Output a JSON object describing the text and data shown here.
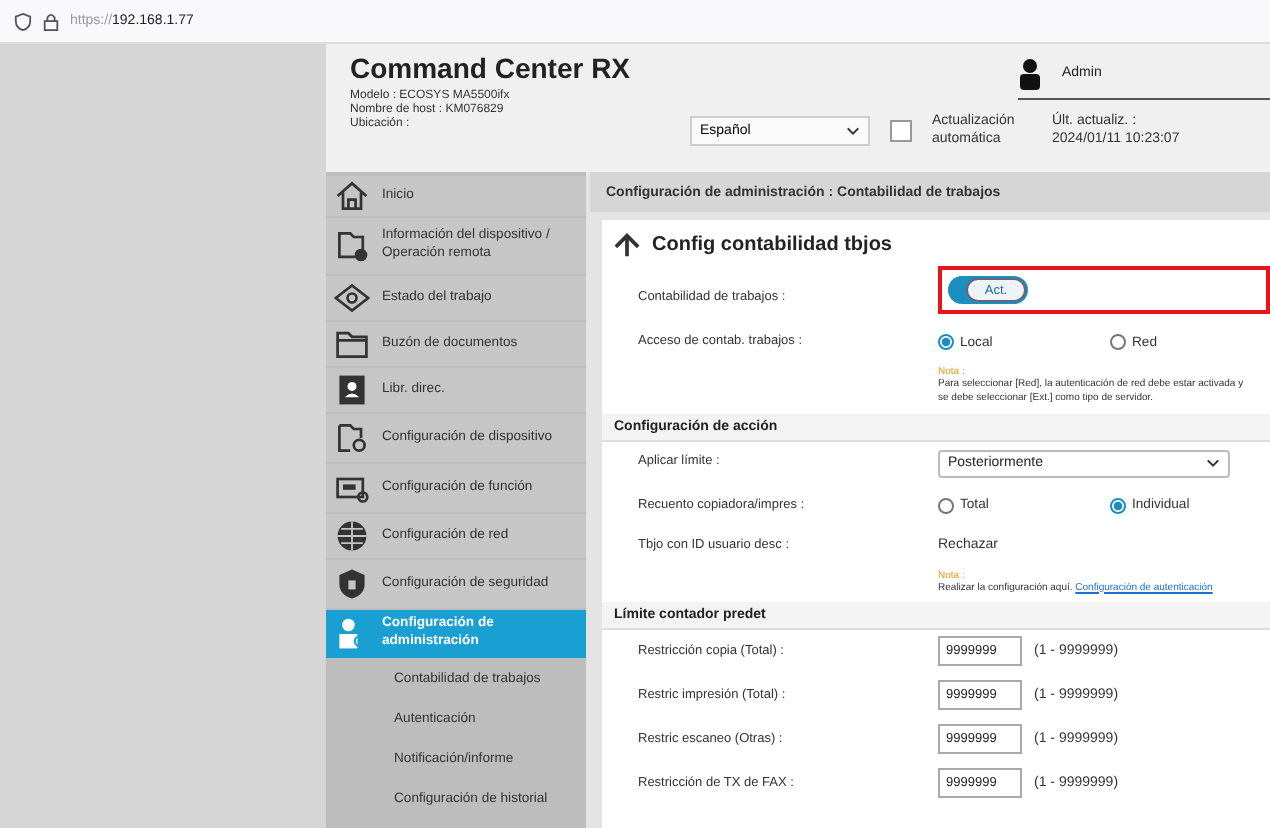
{
  "browser": {
    "url_scheme": "https://",
    "url_host": "192.168.1.77"
  },
  "header": {
    "title": "Command Center RX",
    "info": [
      {
        "label": "Modelo :",
        "value": "ECOSYS MA5500ifx"
      },
      {
        "label": "Nombre de host :",
        "value": "KM076829"
      },
      {
        "label": "Ubicación :"
      }
    ],
    "language": "Español",
    "auto_update": {
      "label": "Actualización automática",
      "checked": false
    },
    "last_update": {
      "label": "Últ. actualiz. :",
      "value": "2024/01/11 10:23:07"
    },
    "user": "Admin"
  },
  "sidebar": {
    "items": [
      {
        "label": "Inicio",
        "selected": false
      },
      {
        "label": "Información del dispositivo / Operación remota",
        "selected": false
      },
      {
        "label": "Estado del trabajo",
        "selected": false
      },
      {
        "label": "Buzón de documentos",
        "selected": false
      },
      {
        "label": "Libr. direc.",
        "selected": false
      },
      {
        "label": "Configuración de dispositivo",
        "selected": false
      },
      {
        "label": "Configuración de función",
        "selected": false
      },
      {
        "label": "Configuración de red",
        "selected": false
      },
      {
        "label": "Configuración de seguridad",
        "selected": false
      },
      {
        "label": "Configuración de administración",
        "selected": true,
        "children": [
          {
            "label": "Contabilidad de trabajos"
          },
          {
            "label": "Autenticación"
          },
          {
            "label": "Notificación/informe"
          },
          {
            "label": "Configuración de historial"
          }
        ]
      }
    ]
  },
  "main": {
    "breadcrumb": "Configuración de administración : Contabilidad de trabajos",
    "title": "Config contabilidad tbjos",
    "sections": [
      {
        "rows": [
          {
            "kind": "toggle",
            "label": "Contabilidad de trabajos :",
            "value": "Act.",
            "on": true,
            "highlighted": true
          },
          {
            "kind": "radio",
            "label": "Acceso de contab. trabajos :",
            "options": [
              {
                "label": "Local",
                "selected": true
              },
              {
                "label": "Red",
                "selected": false
              }
            ],
            "note": {
              "label": "Nota :",
              "text": "Para seleccionar [Red], la autenticación de red debe estar activada y se debe seleccionar [Ext.] como tipo de servidor."
            }
          }
        ]
      },
      {
        "heading": "Configuración de acción",
        "rows": [
          {
            "kind": "select",
            "label": "Aplicar límite :",
            "value": "Posteriormente"
          },
          {
            "kind": "radio",
            "label": "Recuento copiadora/impres :",
            "options": [
              {
                "label": "Total",
                "selected": false
              },
              {
                "label": "Individual",
                "selected": true
              }
            ]
          },
          {
            "kind": "text",
            "label": "Tbjo con ID usuario desc :",
            "value": "Rechazar",
            "note": {
              "label": "Nota :",
              "text": "Realizar la configuración aquí.",
              "link": "Configuración de autenticación"
            }
          }
        ]
      },
      {
        "heading": "Límite contador predet",
        "rows": [
          {
            "kind": "number",
            "label": "Restricción copia (Total) :",
            "value": "9999999",
            "range": "(1 - 9999999)"
          },
          {
            "kind": "number",
            "label": "Restric impresión (Total) :",
            "value": "9999999",
            "range": "(1 - 9999999)"
          },
          {
            "kind": "number",
            "label": "Restric escaneo (Otras) :",
            "value": "9999999",
            "range": "(1 - 9999999)"
          },
          {
            "kind": "number",
            "label": "Restricción de TX de FAX :",
            "value": "9999999",
            "range": "(1 - 9999999)"
          }
        ]
      }
    ]
  }
}
